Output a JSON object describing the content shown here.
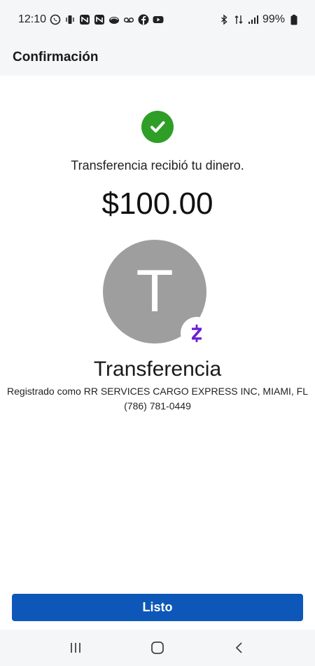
{
  "status_bar": {
    "time": "12:10",
    "battery": "99%",
    "left_icons": [
      "whatsapp-icon",
      "vibrate-icon",
      "news-icon",
      "news-icon",
      "app-icon",
      "voicemail-icon",
      "facebook-icon",
      "youtube-icon"
    ],
    "right_icons": [
      "bluetooth-icon",
      "data-icon",
      "signal-icon",
      "battery-icon"
    ]
  },
  "header": {
    "title": "Confirmación"
  },
  "confirmation": {
    "message": "Transferencia recibió tu dinero.",
    "amount": "$100.00",
    "icon": "checkmark-icon",
    "accent": "#2e9e27"
  },
  "recipient": {
    "avatar_letter": "T",
    "avatar_color": "#9e9e9e",
    "badge_icon": "zelle-icon",
    "badge_color": "#6d1ed4",
    "name": "Transferencia",
    "registered_as": "Registrado como RR SERVICES CARGO EXPRESS INC, MIAMI, FL",
    "phone": "(786) 781-0449"
  },
  "actions": {
    "done_label": "Listo",
    "button_color": "#0d57b8"
  },
  "nav_bar": {
    "buttons": [
      "recents-icon",
      "home-icon",
      "back-icon"
    ]
  }
}
